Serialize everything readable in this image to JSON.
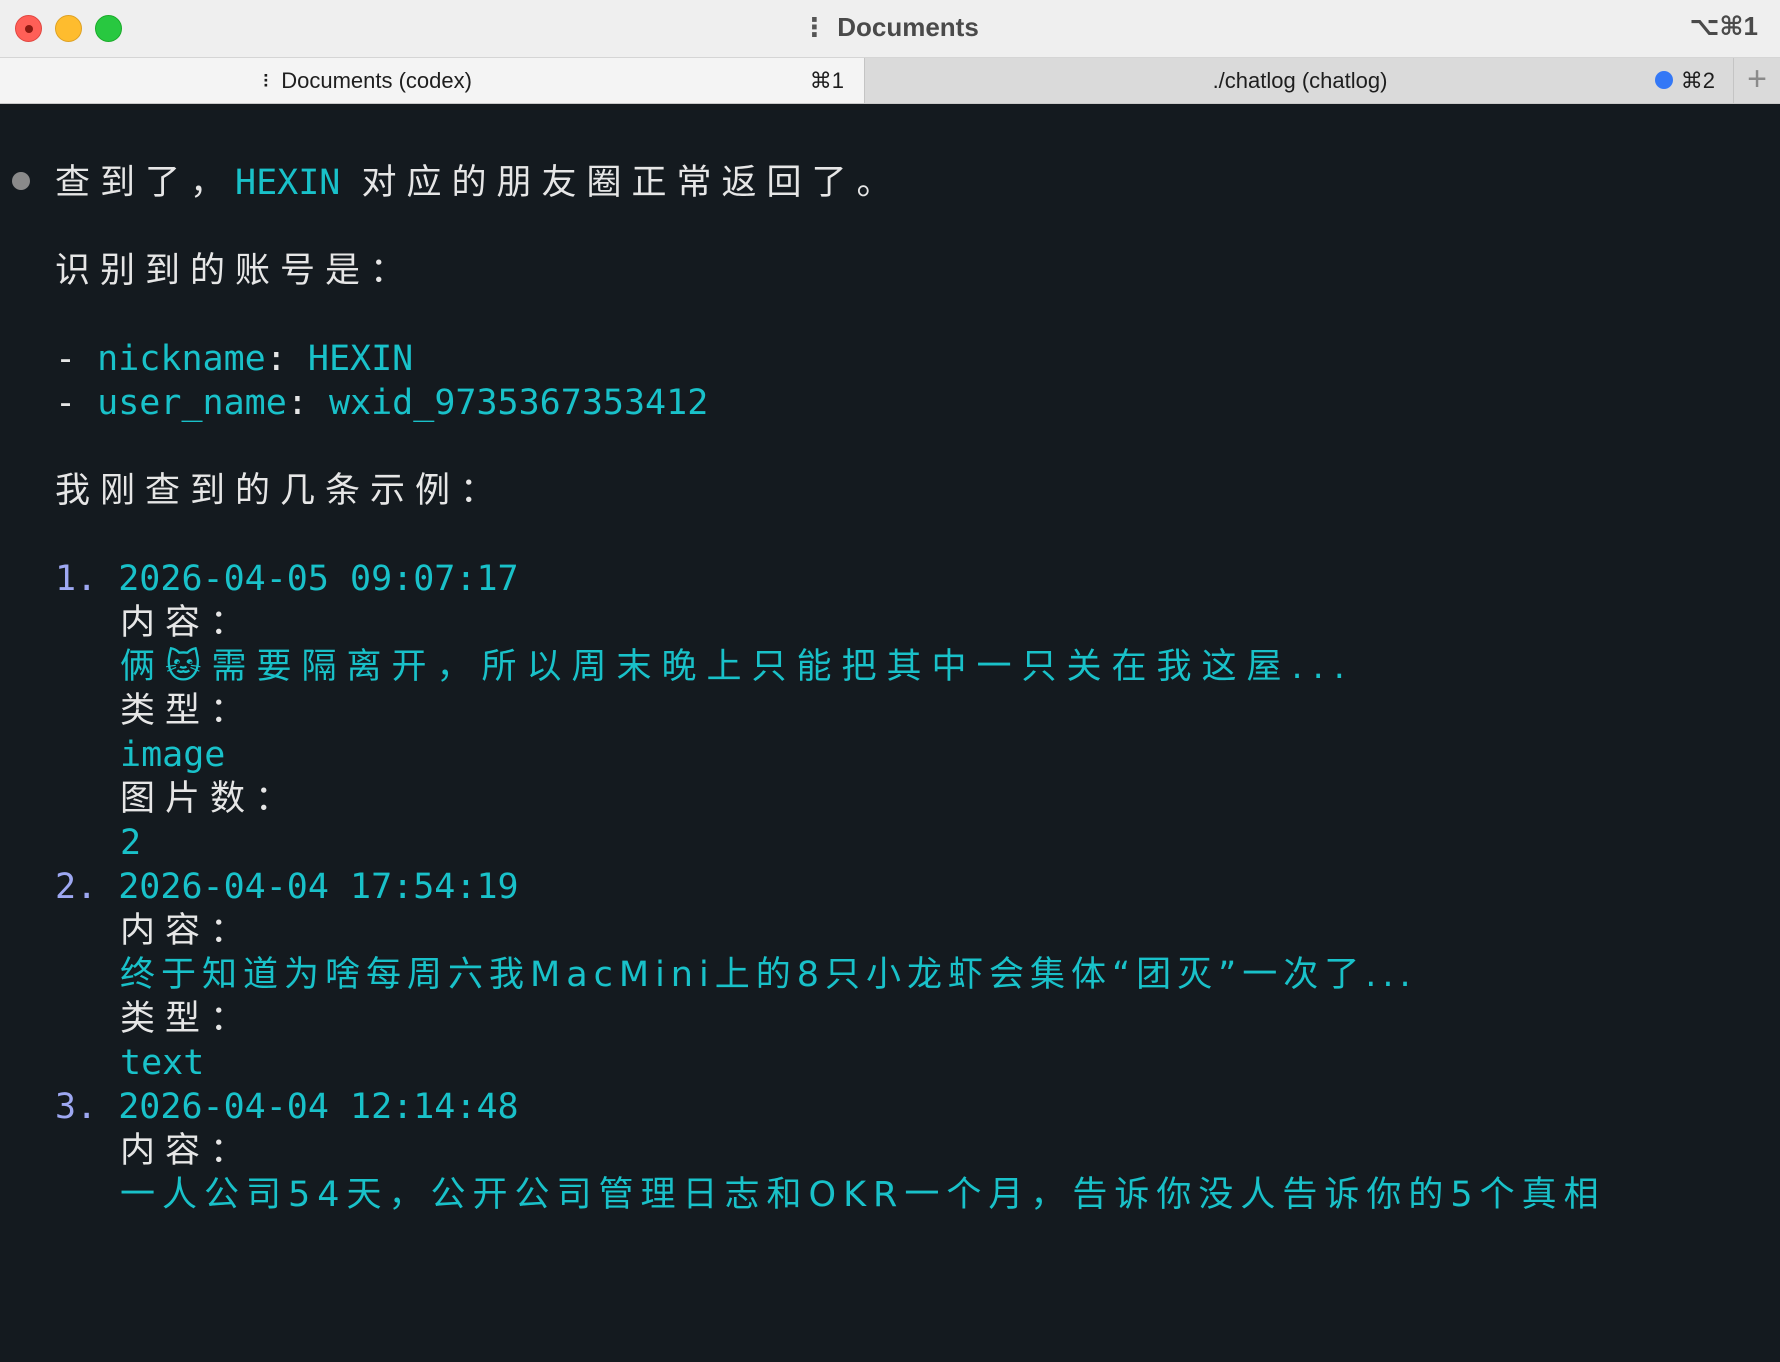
{
  "window": {
    "title": "Documents",
    "title_shortcut": "⌥⌘1"
  },
  "tabs": [
    {
      "label": "Documents (codex)",
      "shortcut": "⌘1",
      "active": true
    },
    {
      "label": "./chatlog (chatlog)",
      "shortcut": "⌘2",
      "active": false,
      "indicator_color": "#3478f6"
    }
  ],
  "new_tab_symbol": "+",
  "terminal": {
    "intro": {
      "pre": "查到了，",
      "highlight": "HEXIN",
      "post": " 对应的朋友圈正常返回了。"
    },
    "account_heading": "识别到的账号是：",
    "account": [
      {
        "key": "nickname",
        "value": "HEXIN"
      },
      {
        "key": "user_name",
        "value": "wxid_9735367353412"
      }
    ],
    "examples_heading": "我刚查到的几条示例：",
    "labels": {
      "content": "内容：",
      "type": "类型：",
      "image_count": "图片数："
    },
    "examples": [
      {
        "num": "1.",
        "time": "2026-04-05 09:07:17",
        "content": "俩🐱需要隔离开，所以周末晚上只能把其中一只关在我这屋...",
        "type": "image",
        "image_count": "2"
      },
      {
        "num": "2.",
        "time": "2026-04-04 17:54:19",
        "content": "终于知道为啥每周六我MacMini上的8只小龙虾会集体“团灭”一次了...",
        "type": "text"
      },
      {
        "num": "3.",
        "time": "2026-04-04 12:14:48",
        "content": "一人公司54天，公开公司管理日志和OKR一个月，告诉你没人告诉你的5个真相"
      }
    ]
  },
  "colors": {
    "accent_cyan": "#19c1c9",
    "list_number": "#9ea8f2",
    "background": "#141a1f"
  }
}
